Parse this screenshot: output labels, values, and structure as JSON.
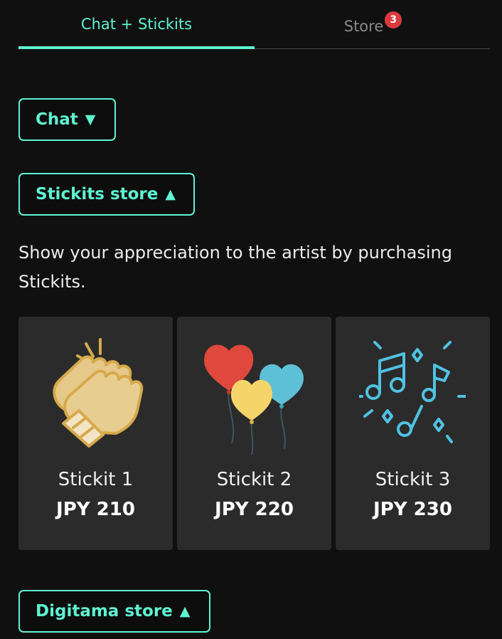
{
  "tabs": {
    "chat_label": "Chat + Stickits",
    "store_label": "Store",
    "store_badge": "3"
  },
  "sections": {
    "chat_label": "Chat",
    "chat_caret": "▼",
    "stickits_label": "Stickits store",
    "stickits_caret": "▲",
    "digitama_label": "Digitama store",
    "digitama_caret": "▲"
  },
  "stickits": {
    "description": "Show your appreciation to the artist by purchasing Stickits.",
    "items": [
      {
        "name": "Stickit 1",
        "price": "JPY 210",
        "icon": "clapping-hands-icon"
      },
      {
        "name": "Stickit 2",
        "price": "JPY 220",
        "icon": "heart-balloons-icon"
      },
      {
        "name": "Stickit 3",
        "price": "JPY 230",
        "icon": "music-notes-icon"
      }
    ]
  },
  "colors": {
    "accent": "#5ff3d1",
    "background": "#101010",
    "card": "#2b2b2b",
    "badge": "#d93a40"
  }
}
